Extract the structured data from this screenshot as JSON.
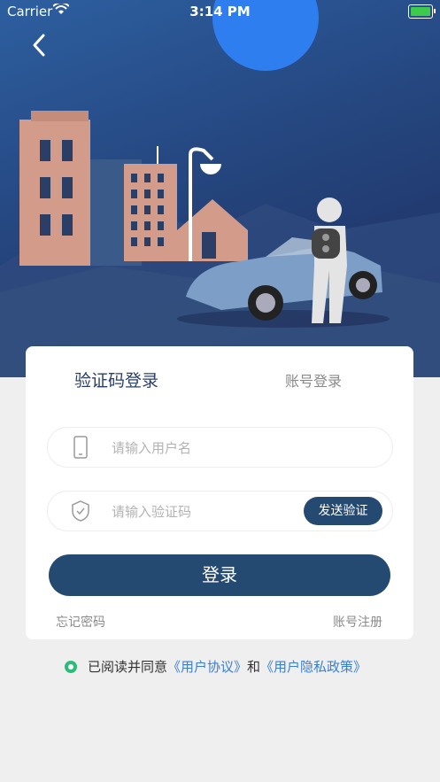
{
  "status_bar": {
    "carrier": "Carrier",
    "time": "3:14 PM"
  },
  "nav": {
    "back_icon": "chevron-left-icon"
  },
  "tabs": {
    "sms_login": "验证码登录",
    "account_login": "账号登录"
  },
  "form": {
    "username_placeholder": "请输入用户名",
    "code_placeholder": "请输入验证码",
    "send_code_label": "发送验证",
    "login_label": "登录"
  },
  "links": {
    "forgot_password": "忘记密码",
    "register": "账号注册"
  },
  "agreement": {
    "prefix": "已阅读并同意",
    "user_agreement": "《用户协议》",
    "and": "和",
    "privacy_policy": "《用户隐私政策》"
  },
  "colors": {
    "primary": "#254a72",
    "link": "#3a7fd1",
    "check": "#2dbb7a",
    "hero_top": "#2d5fa0",
    "hero_bottom": "#1d2d5e"
  },
  "icons": [
    "wifi-icon",
    "battery-icon",
    "chevron-left-icon",
    "phone-icon",
    "shield-check-icon",
    "radio-checked-icon"
  ]
}
